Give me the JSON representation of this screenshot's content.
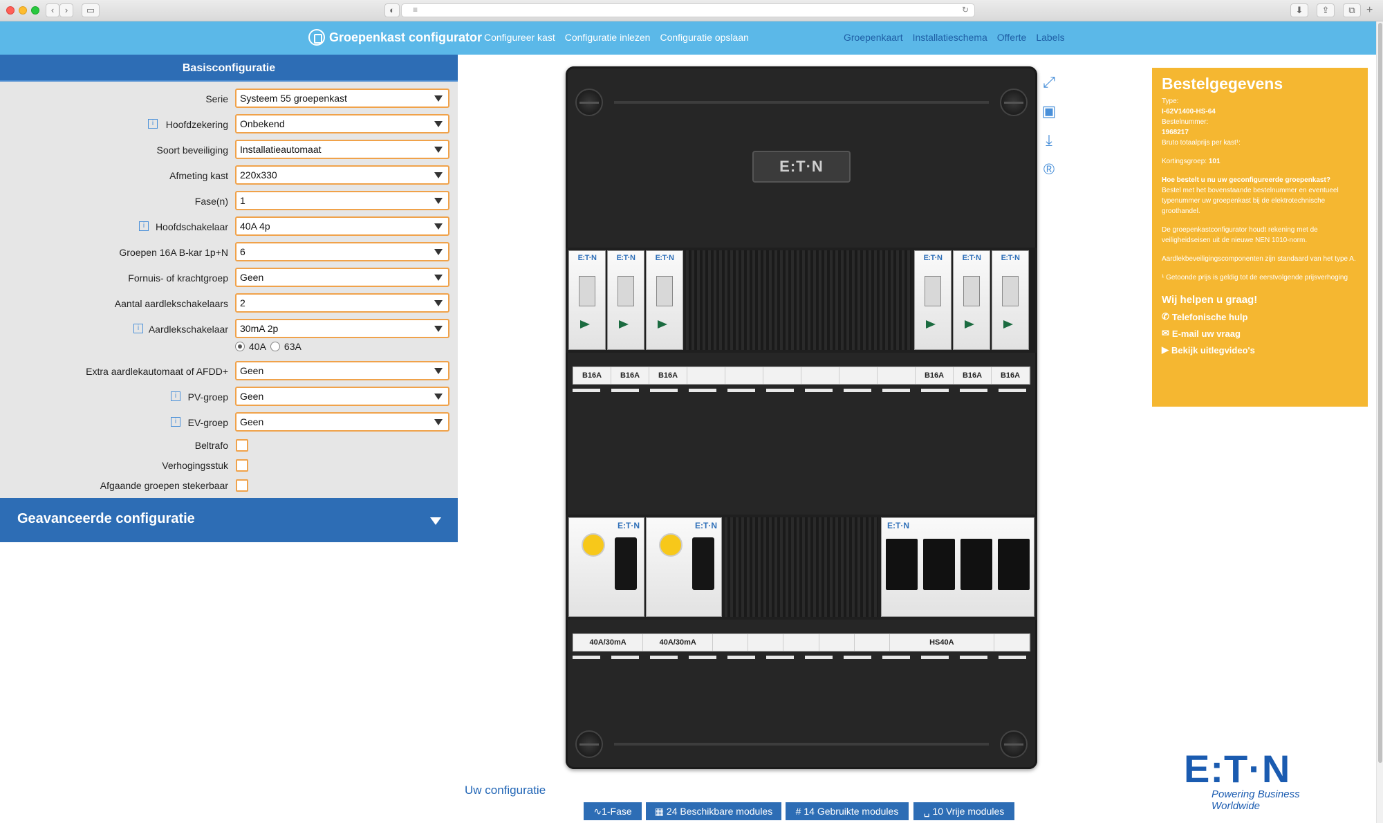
{
  "header": {
    "brand": "Groepenkast configurator",
    "nav_left": [
      "Configureer kast",
      "Configuratie inlezen",
      "Configuratie opslaan"
    ],
    "nav_right": [
      "Groepenkaart",
      "Installatieschema",
      "Offerte",
      "Labels"
    ]
  },
  "left": {
    "title": "Basisconfiguratie",
    "fields": [
      {
        "label": "Serie",
        "value": "Systeem 55 groepenkast"
      },
      {
        "label": "Hoofdzekering",
        "value": "Onbekend"
      },
      {
        "label": "Soort beveiliging",
        "value": "Installatieautomaat"
      },
      {
        "label": "Afmeting kast",
        "value": "220x330"
      },
      {
        "label": "Fase(n)",
        "value": "1"
      },
      {
        "label": "Hoofdschakelaar",
        "value": "40A 4p"
      },
      {
        "label": "Groepen 16A B-kar 1p+N",
        "value": "6"
      },
      {
        "label": "Fornuis- of krachtgroep",
        "value": "Geen"
      },
      {
        "label": "Aantal aardlekschakelaars",
        "value": "2"
      },
      {
        "label": "Aardlekschakelaar",
        "value": "30mA 2p"
      },
      {
        "label": "Extra aardlekautomaat of AFDD+",
        "value": "Geen"
      },
      {
        "label": "PV-groep",
        "value": "Geen"
      },
      {
        "label": "EV-groep",
        "value": "Geen"
      }
    ],
    "radio": {
      "opt1": "40A",
      "opt2": "63A"
    },
    "checkboxes": [
      "Beltrafo",
      "Verhogingsstuk",
      "Afgaande groepen stekerbaar"
    ],
    "advanced": "Geavanceerde configuratie"
  },
  "cabinet": {
    "brand_plate": "E:T·N",
    "module_brand": "E:T·N",
    "top_labels": [
      "B16A",
      "B16A",
      "B16A",
      "",
      "",
      "",
      "",
      "",
      "",
      "B16A",
      "B16A",
      "B16A"
    ],
    "bottom_labels": [
      "40A/30mA",
      "40A/30mA",
      "",
      "",
      "",
      "",
      "",
      "HS40A",
      ""
    ]
  },
  "order": {
    "title": "Bestelgegevens",
    "type_label": "Type:",
    "type_value": "I-62V1400-HS-64",
    "bestel_label": "Bestelnummer:",
    "bestel_value": "1968217",
    "bruto": "Bruto totaalprijs per kast¹:",
    "korting_label": "Kortingsgroep:",
    "korting_value": "101",
    "q_title": "Hoe bestelt u nu uw geconfigureerde groepenkast?",
    "q_text": "Bestel met het bovenstaande bestelnummer en eventueel typenummer uw groepenkast bij de elektrotechnische groothandel.",
    "nen": "De groepenkastconfigurator houdt rekening met de veiligheidseisen uit de nieuwe NEN 1010-norm.",
    "aard": "Aardlekbeveiligingscomponenten zijn standaard van het type A.",
    "footnote": "¹ Getoonde prijs is geldig tot de eerstvolgende prijsverhoging",
    "help_title": "Wij helpen u graag!",
    "help_links": [
      "Telefonische hulp",
      "E-mail uw vraag",
      "Bekijk uitlegvideo's"
    ]
  },
  "logo": {
    "word": "E:T·N",
    "tagline": "Powering Business Worldwide"
  },
  "bottom": {
    "title": "Uw configuratie",
    "buttons": [
      "1-Fase",
      "24 Beschikbare modules",
      "14 Gebruikte modules",
      "10 Vrije modules"
    ]
  }
}
